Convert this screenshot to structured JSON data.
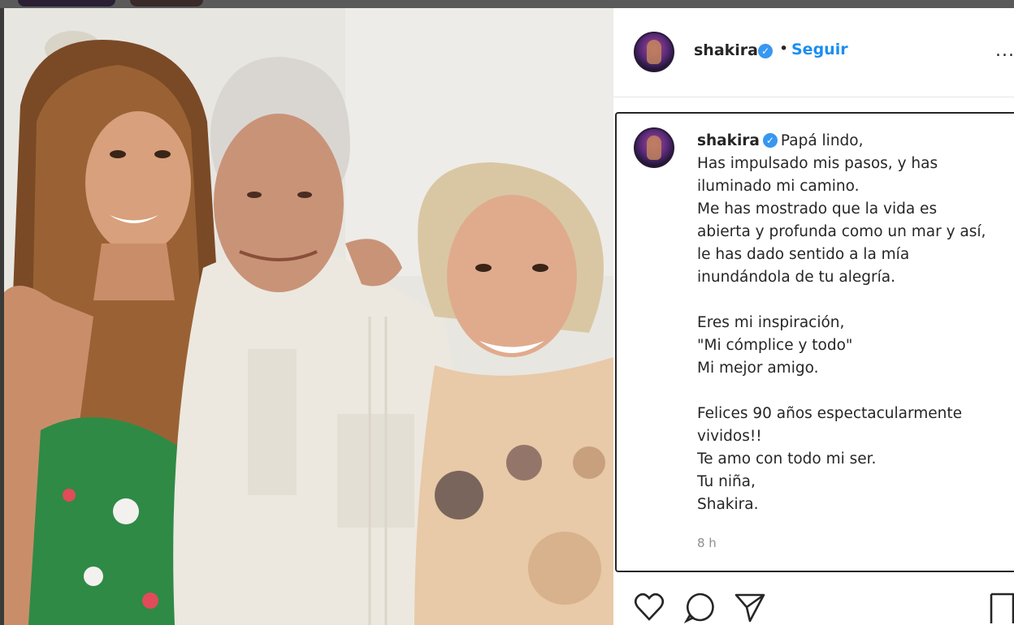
{
  "post": {
    "username": "shakira",
    "separator": "•",
    "follow_label": "Seguir",
    "more_label": "...",
    "caption_lines": [
      "Papá lindo,",
      "Has impulsado mis pasos, y has",
      "iluminado mi camino.",
      "Me has mostrado que la vida es",
      "abierta y profunda como un mar y así,",
      "le has dado sentido a la mía",
      "inundándola de tu alegría.",
      "",
      "Eres mi inspiración,",
      "\"Mi cómplice y todo\"",
      "Mi mejor amigo.",
      "",
      "Felices 90 años espectacularmente",
      "vividos!!",
      "Te amo con todo mi ser.",
      "Tu niña,",
      "Shakira."
    ],
    "time": "8 h"
  },
  "icons": {
    "verified": "verified-badge-icon",
    "like": "heart-icon",
    "comment": "comment-icon",
    "share": "paper-plane-icon",
    "save": "bookmark-icon"
  },
  "colors": {
    "accent": "#1b8ef0",
    "verified": "#3897f0",
    "text": "#262626",
    "muted": "#8e8e8e"
  }
}
